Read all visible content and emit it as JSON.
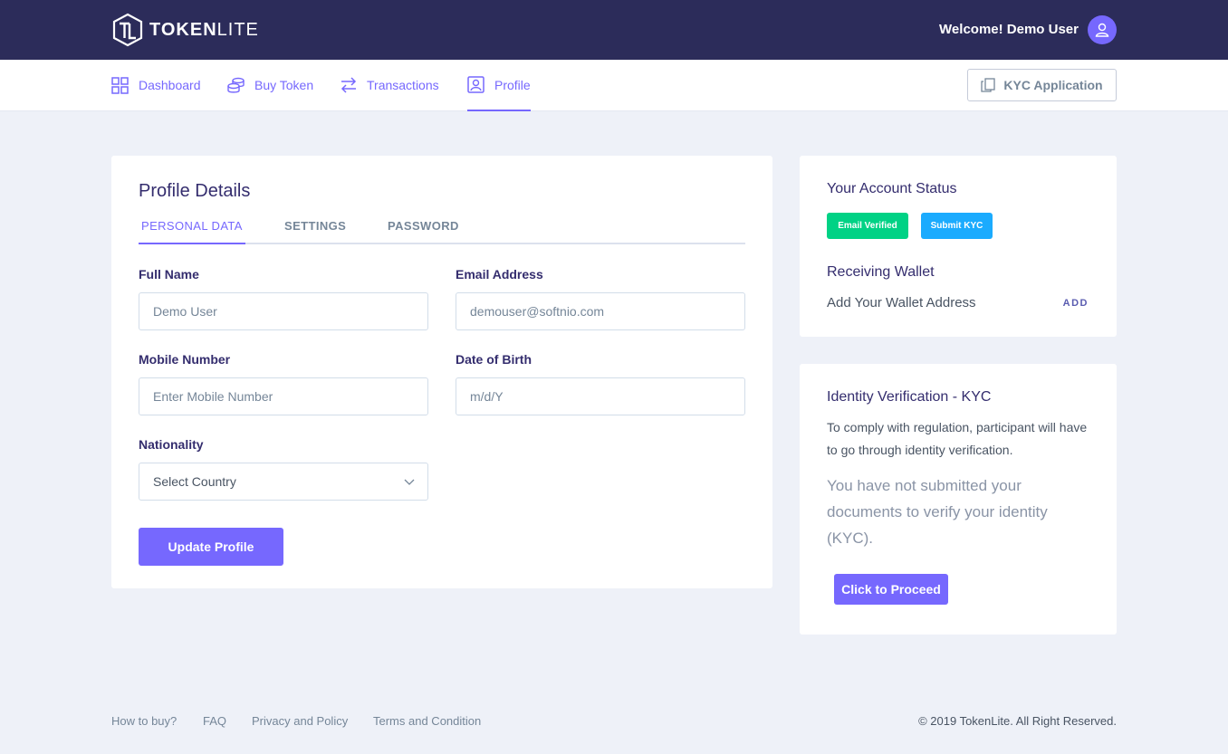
{
  "header": {
    "logo_bold": "TOKEN",
    "logo_light": "LITE",
    "welcome": "Welcome! Demo User"
  },
  "nav": {
    "items": [
      {
        "label": "Dashboard",
        "icon": "dashboard-icon"
      },
      {
        "label": "Buy Token",
        "icon": "coins-icon"
      },
      {
        "label": "Transactions",
        "icon": "transfer-icon"
      },
      {
        "label": "Profile",
        "icon": "profile-icon",
        "active": true
      }
    ],
    "kyc_button": "KYC Application"
  },
  "profile": {
    "title": "Profile Details",
    "tabs": [
      "PERSONAL DATA",
      "SETTINGS",
      "PASSWORD"
    ],
    "active_tab": "PERSONAL DATA",
    "fields": {
      "full_name": {
        "label": "Full Name",
        "placeholder": "Demo User"
      },
      "email": {
        "label": "Email Address",
        "placeholder": "demouser@softnio.com"
      },
      "mobile": {
        "label": "Mobile Number",
        "placeholder": "Enter Mobile Number"
      },
      "dob": {
        "label": "Date of Birth",
        "placeholder": "m/d/Y"
      },
      "nationality": {
        "label": "Nationality",
        "selected": "Select Country"
      }
    },
    "update_button": "Update Profile"
  },
  "account_status": {
    "title": "Your Account Status",
    "badges": [
      {
        "label": "Email Verified",
        "color": "#00d285"
      },
      {
        "label": "Submit KYC",
        "color": "#1babfe"
      }
    ],
    "wallet_title": "Receiving Wallet",
    "wallet_text": "Add Your Wallet Address",
    "add_link": "ADD"
  },
  "kyc": {
    "title": "Identity Verification - KYC",
    "description": "To comply with regulation, participant will have to go through identity verification.",
    "note": "You have not submitted your documents to verify your identity (KYC).",
    "proceed_button": "Click to Proceed"
  },
  "footer": {
    "links": [
      "How to buy?",
      "FAQ",
      "Privacy and Policy",
      "Terms and Condition"
    ],
    "copyright": "© 2019 TokenLite. All Right Reserved."
  },
  "colors": {
    "accent": "#7668fe",
    "header_bg": "#2c2c5a",
    "page_bg": "#eef1f8"
  }
}
